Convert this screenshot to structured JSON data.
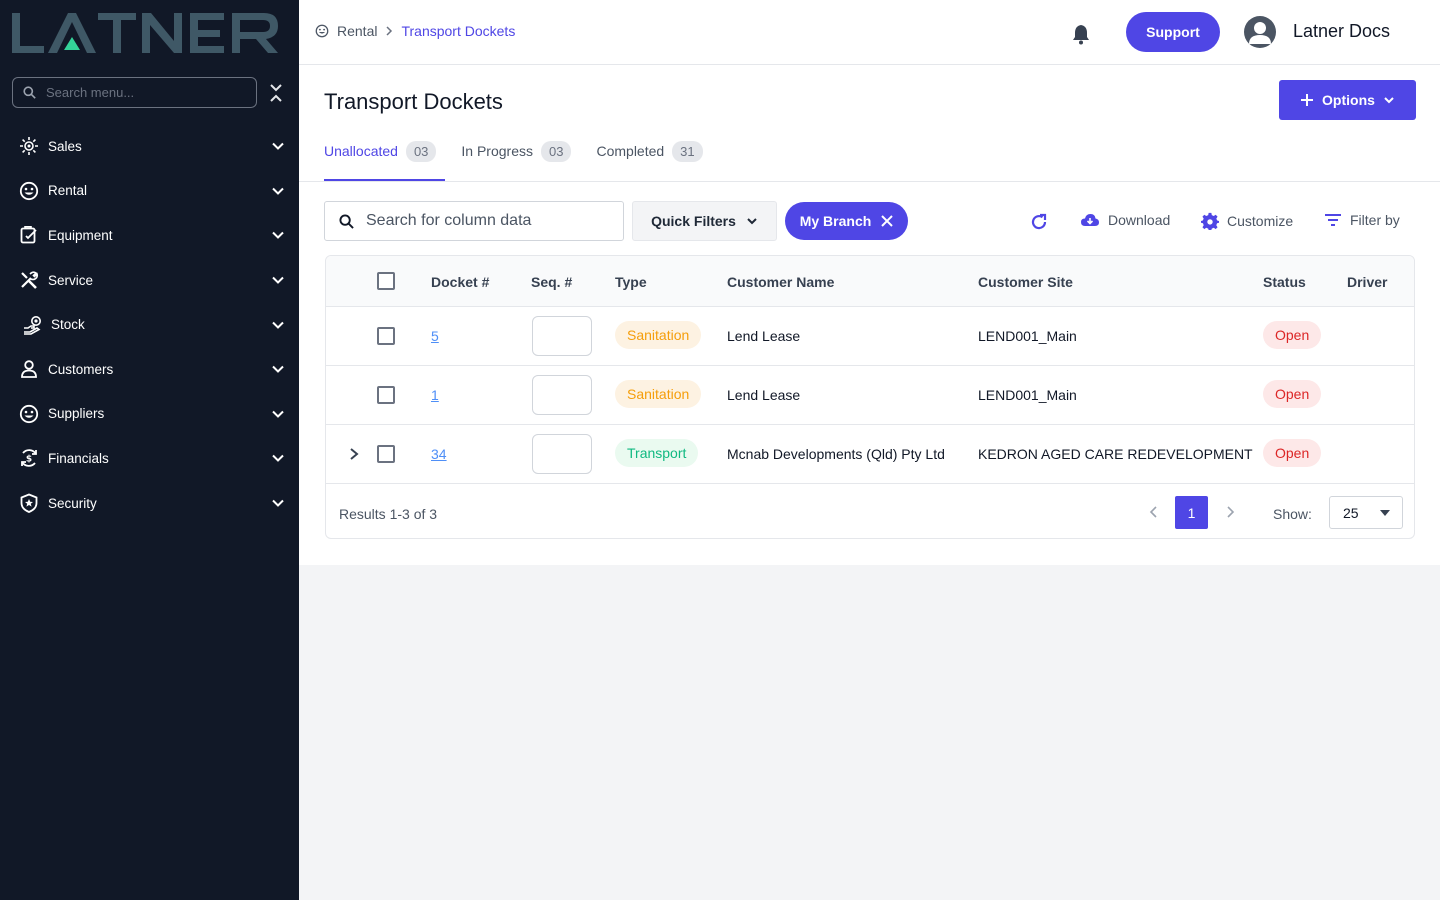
{
  "app": {
    "logo_text": "LATNER",
    "menu_search_placeholder": "Search menu..."
  },
  "sidebar": {
    "items": [
      {
        "label": "Sales",
        "icon": "sales-icon"
      },
      {
        "label": "Rental",
        "icon": "rental-icon"
      },
      {
        "label": "Equipment",
        "icon": "equipment-icon"
      },
      {
        "label": "Service",
        "icon": "service-icon"
      },
      {
        "label": "Stock",
        "icon": "stock-icon"
      },
      {
        "label": "Customers",
        "icon": "customers-icon"
      },
      {
        "label": "Suppliers",
        "icon": "suppliers-icon"
      },
      {
        "label": "Financials",
        "icon": "financials-icon"
      },
      {
        "label": "Security",
        "icon": "security-icon"
      }
    ]
  },
  "header": {
    "breadcrumb": [
      "Rental",
      "Transport Dockets"
    ],
    "support_label": "Support",
    "user_name": "Latner Docs"
  },
  "page": {
    "title": "Transport Dockets",
    "options_label": "Options",
    "tabs": [
      {
        "label": "Unallocated",
        "count": "03",
        "active": true
      },
      {
        "label": "In Progress",
        "count": "03",
        "active": false
      },
      {
        "label": "Completed",
        "count": "31",
        "active": false
      }
    ]
  },
  "toolbar": {
    "search_placeholder": "Search for column data",
    "quick_filters_label": "Quick Filters",
    "branch_chip_label": "My Branch",
    "download_label": "Download",
    "customize_label": "Customize",
    "filter_label": "Filter by"
  },
  "table": {
    "columns": [
      "Docket #",
      "Seq. #",
      "Type",
      "Customer Name",
      "Customer Site",
      "Status",
      "Driver"
    ],
    "rows": [
      {
        "docket": "5",
        "seq": "",
        "type": "Sanitation",
        "type_style": "san",
        "customer": "Lend Lease",
        "site": "LEND001_Main",
        "status": "Open",
        "driver": "",
        "expandable": false
      },
      {
        "docket": "1",
        "seq": "",
        "type": "Sanitation",
        "type_style": "san",
        "customer": "Lend Lease",
        "site": "LEND001_Main",
        "status": "Open",
        "driver": "",
        "expandable": false
      },
      {
        "docket": "34",
        "seq": "",
        "type": "Transport",
        "type_style": "trn",
        "customer": "Mcnab Developments (Qld) Pty Ltd",
        "site": "KEDRON AGED CARE REDEVELOPMENT",
        "status": "Open",
        "driver": "",
        "expandable": true
      }
    ]
  },
  "pagination": {
    "results_text": "Results 1-3 of 3",
    "current_page": "1",
    "show_label": "Show:",
    "page_size": "25"
  },
  "colors": {
    "accent": "#4f46e5",
    "sidebar_bg": "#111827",
    "logo_color": "#3f5866",
    "logo_triangle": "#34d399"
  }
}
